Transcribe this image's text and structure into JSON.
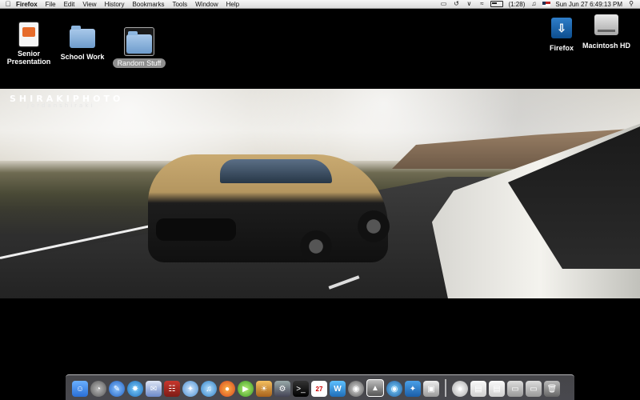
{
  "menubar": {
    "app_name": "Firefox",
    "menus": [
      "File",
      "Edit",
      "View",
      "History",
      "Bookmarks",
      "Tools",
      "Window",
      "Help"
    ],
    "battery": "(1:28)",
    "datetime": "Sun Jun 27  6:49:13 PM"
  },
  "desktop": {
    "icons": [
      {
        "label": "Senior\nPresentation"
      },
      {
        "label": "School Work"
      },
      {
        "label": "Random Stuff"
      },
      {
        "label": "Firefox"
      },
      {
        "label": "Macintosh HD"
      }
    ]
  },
  "wallpaper": {
    "brand": "SHIRAKIPHOTO",
    "sub": "jordanshiraki"
  },
  "dock": {
    "calendar_day": "27"
  }
}
